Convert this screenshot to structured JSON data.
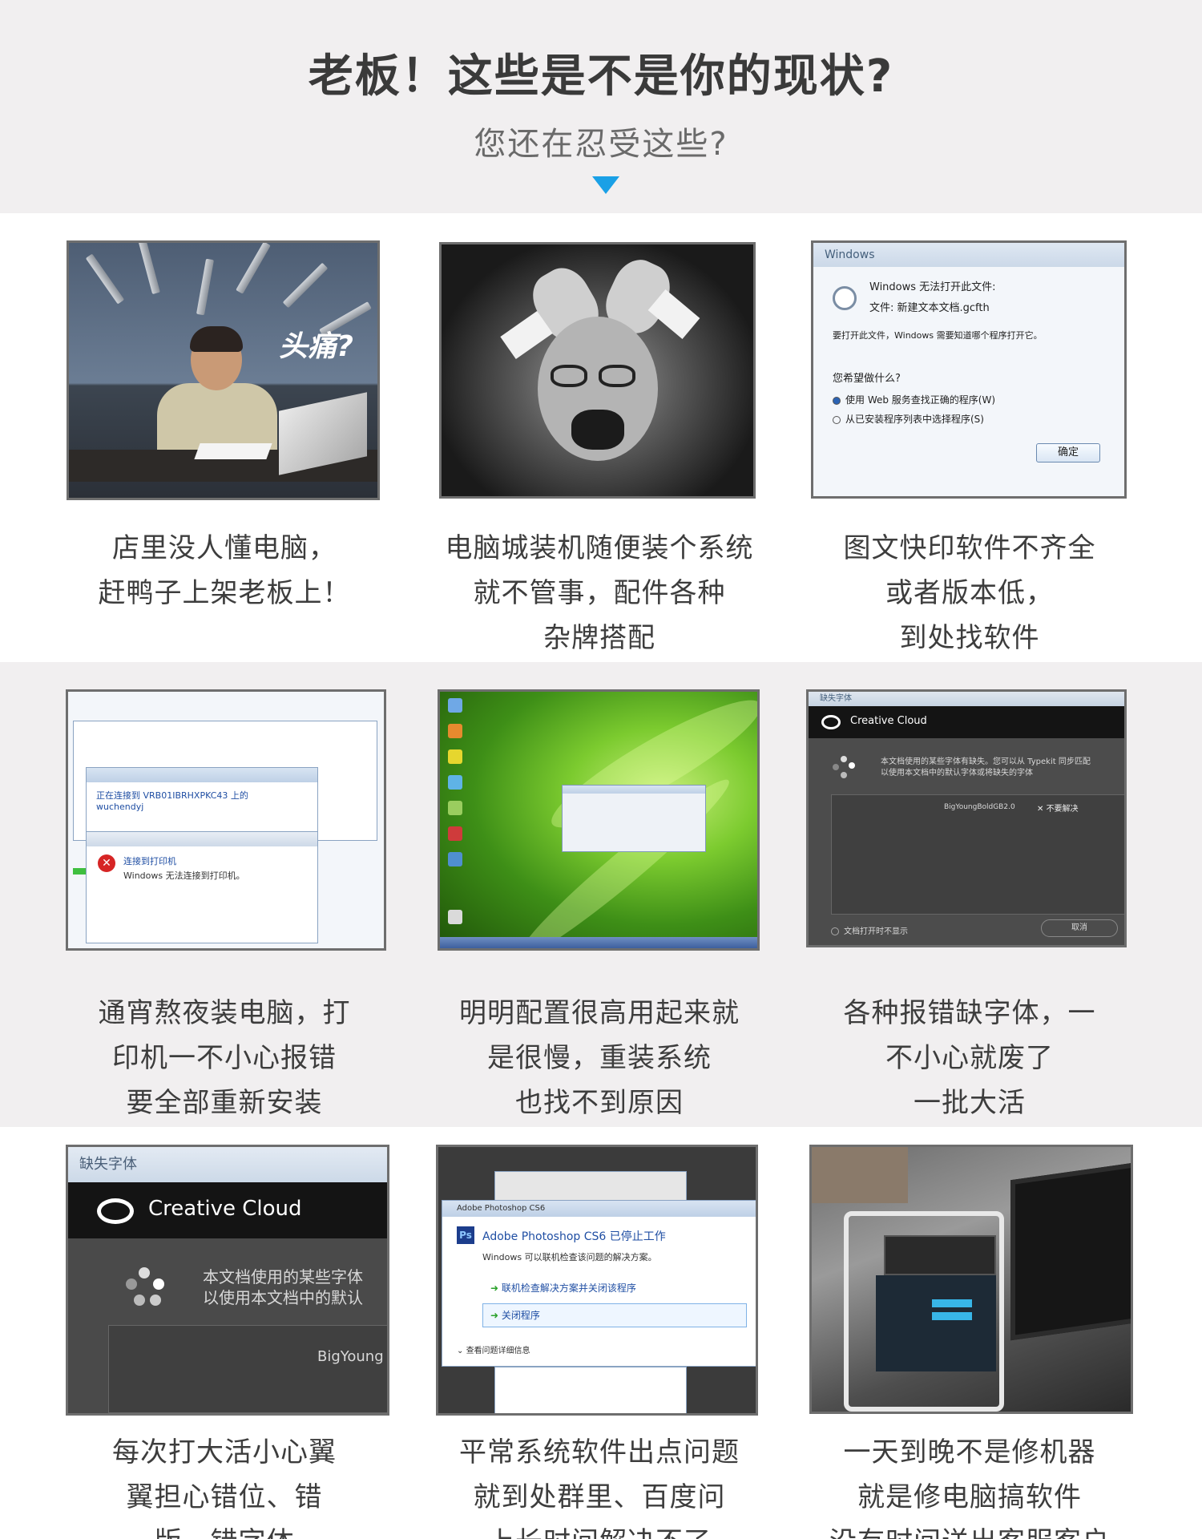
{
  "header": {
    "title": "老板！这些是不是你的现状?",
    "subtitle": "您还在忍受这些?"
  },
  "cards": [
    {
      "caption": [
        "店里没人懂电脑，",
        "赶鸭子上架老板上！"
      ],
      "image": {
        "overlay_text": "头痛?"
      }
    },
    {
      "caption": [
        "电脑城装机随便装个系统",
        "就不管事，配件各种",
        "杂牌搭配"
      ]
    },
    {
      "caption": [
        "图文快印软件不齐全",
        "或者版本低，",
        "到处找软件"
      ],
      "image": {
        "window_title": "Windows",
        "lines": [
          "Windows 无法打开此文件:",
          "文件:    新建文本文档.gcfth",
          "要打开此文件，Windows 需要知道哪个程序打开它。",
          "您希望做什么?"
        ],
        "options": [
          "使用 Web 服务查找正确的程序(W)",
          "从已安装程序列表中选择程序(S)"
        ],
        "button": "确定"
      }
    },
    {
      "caption": [
        "通宵熬夜装电脑，打",
        "印机一不小心报错",
        "要全部重新安装"
      ],
      "image": {
        "lines": [
          "正在连接到 VRB01IBRHXPKC43 上的",
          "wuchendyj",
          "连接到打印机",
          "Windows 无法连接到打印机。"
        ]
      }
    },
    {
      "caption": [
        "明明配置很高用起来就",
        "是很慢，重装系统",
        "也找不到原因"
      ]
    },
    {
      "caption": [
        "各种报错缺字体，一",
        "不小心就废了",
        "一批大活"
      ],
      "image": {
        "window_title": "缺失字体",
        "brand": "Creative Cloud",
        "text": [
          "本文档使用的某些字体有缺失。您可以从 Typekit 同步匹配",
          "以使用本文档中的默认字体或将缺失的字体"
        ],
        "font_item": "BigYoungBoldGB2.0",
        "status": "不要解决",
        "checkbox": "文档打开时不显示",
        "button": "取消"
      }
    },
    {
      "caption": [
        "每次打大活小心翼",
        "翼担心错位、错",
        "版、错字体"
      ],
      "image": {
        "window_title": "缺失字体",
        "brand": "Creative Cloud",
        "text": [
          "本文档使用的某些字体",
          "以使用本文档中的默认"
        ],
        "font_item": "BigYoung"
      }
    },
    {
      "caption": [
        "平常系统软件出点问题",
        "就到处群里、百度问",
        "上长时间解决不了"
      ],
      "image": {
        "window_title": "Adobe Photoshop CS6",
        "heading": "Adobe Photoshop CS6 已停止工作",
        "lines": [
          "Windows 可以联机检查该问题的解决方案。",
          "联机检查解决方案并关闭该程序",
          "关闭程序",
          "查看问题详细信息"
        ]
      }
    },
    {
      "caption": [
        "一天到晚不是修机器",
        "就是修电脑搞软件",
        "没有时间送出客服客户"
      ]
    }
  ],
  "colors": {
    "accent_arrow": "#1aa0e6",
    "band_gray": "#f1eff0",
    "text_dark": "#3a3a3a"
  }
}
